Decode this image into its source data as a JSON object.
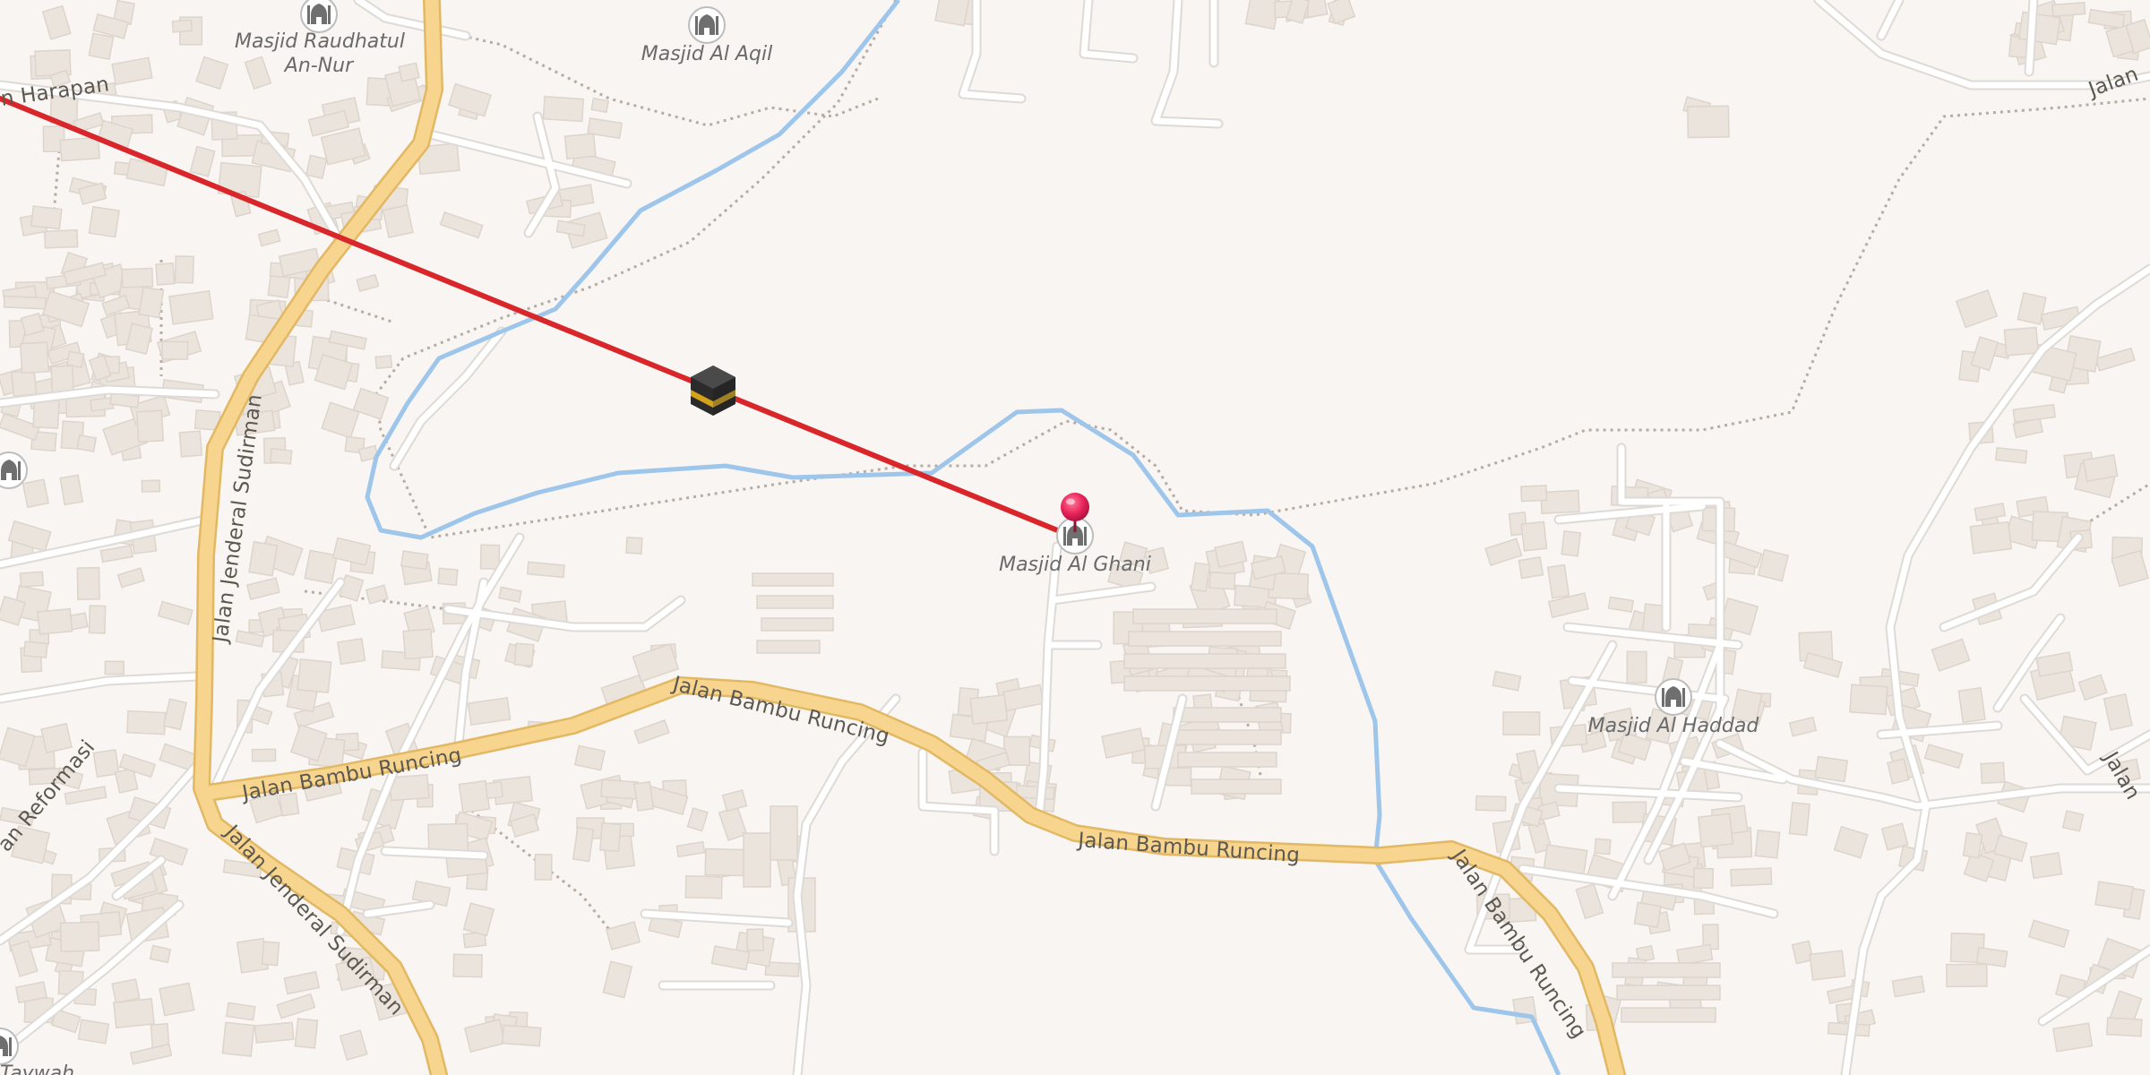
{
  "map": {
    "roads": {
      "sudirman_1": "Jalan Jenderal Sudirman",
      "sudirman_2": "Jalan Jenderal Sudirman",
      "bambu_1": "Jalan Bambu Runcing",
      "bambu_2": "Jalan Bambu Runcing",
      "bambu_3": "Jalan Bambu Runcing",
      "bambu_4": "Jalan Bambu Runcing",
      "harapan": "n Harapan",
      "reformasi": "an Reformasi",
      "topright": "Jalan",
      "rightedge": "Jalan"
    },
    "pois": {
      "raudhatul_line1": "Masjid Raudhatul",
      "raudhatul_line2": "An-Nur",
      "al_aqil": "Masjid Al Aqil",
      "al_ghani": "Masjid Al Ghani",
      "al_haddad": "Masjid Al Haddad",
      "taywah": "Taywah"
    },
    "icons": {
      "mosque": "mosque-icon",
      "kaaba": "kaaba-icon",
      "pin": "location-pin-icon"
    },
    "colors": {
      "background": "#f8f5f2",
      "primary_road": "#f7d58f",
      "river": "#9ec5ea",
      "qibla_line": "#d9262b",
      "pin": "#e8245a"
    }
  }
}
